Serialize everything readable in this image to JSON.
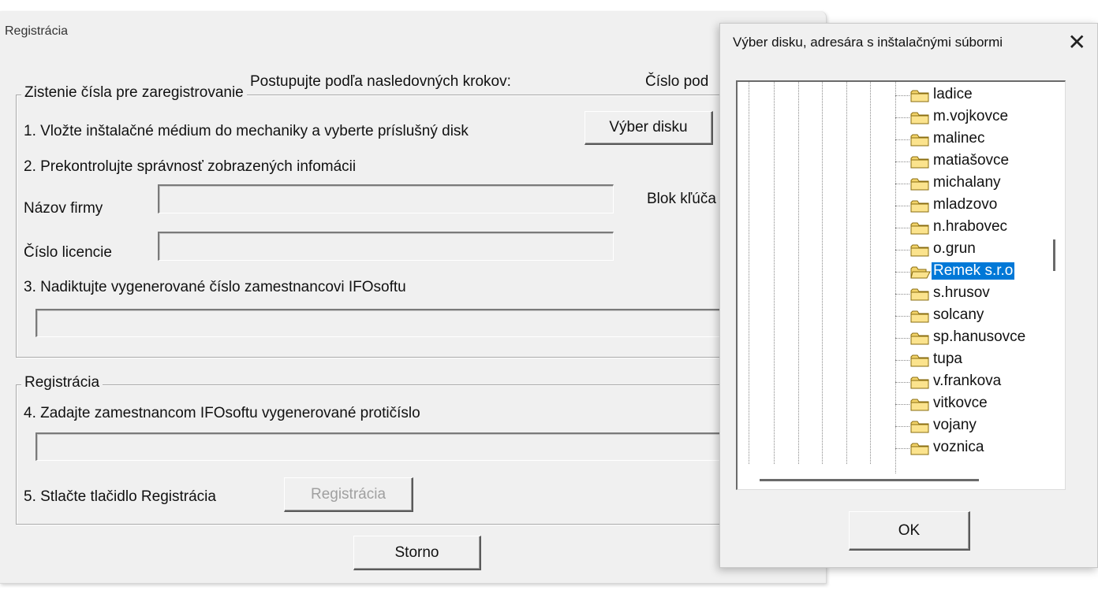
{
  "window": {
    "title": "Registrácia"
  },
  "header": {
    "instructions": "Postupujte podľa nasledovných krokov:",
    "cislo_label": "Číslo pod"
  },
  "group1": {
    "legend": "Zistenie čísla pre zaregistrovanie",
    "step1": "1. Vložte inštalačné médium do mechaniky a vyberte príslušný disk",
    "vyber_disku_button": "Výber disku",
    "step2": "2. Prekontrolujte správnosť zobrazených infomácii",
    "nazov_firmy_label": "Názov firmy",
    "nazov_firmy_value": "",
    "blok_kluca_label": "Blok kľúča",
    "cislo_licencie_label": "Číslo licencie",
    "cislo_licencie_value": "",
    "step3": "3. Nadiktujte vygenerované číslo zamestnancovi IFOsoftu",
    "generated_number_value": ""
  },
  "group2": {
    "legend": "Registrácia",
    "step4": "4. Zadajte zamestnancom IFOsoftu vygenerované protičíslo",
    "proticislo_value": "",
    "step5": "5. Stlačte tlačidlo Registrácia",
    "registracia_button": "Registrácia"
  },
  "storno_button": "Storno",
  "dialog": {
    "title": "Výber disku, adresára s inštalačnými súbormi",
    "close_icon": "close-icon",
    "ok_button": "OK",
    "folders": [
      {
        "name": "ladice",
        "selected": false
      },
      {
        "name": "m.vojkovce",
        "selected": false
      },
      {
        "name": "malinec",
        "selected": false
      },
      {
        "name": "matiašovce",
        "selected": false
      },
      {
        "name": "michalany",
        "selected": false
      },
      {
        "name": "mladzovo",
        "selected": false
      },
      {
        "name": "n.hrabovec",
        "selected": false
      },
      {
        "name": "o.grun",
        "selected": false
      },
      {
        "name": "Remek s.r.o",
        "selected": true
      },
      {
        "name": "s.hrusov",
        "selected": false
      },
      {
        "name": "solcany",
        "selected": false
      },
      {
        "name": "sp.hanusovce",
        "selected": false
      },
      {
        "name": "tupa",
        "selected": false
      },
      {
        "name": "v.frankova",
        "selected": false
      },
      {
        "name": "vitkovce",
        "selected": false
      },
      {
        "name": "vojany",
        "selected": false
      },
      {
        "name": "voznica",
        "selected": false
      }
    ]
  },
  "colors": {
    "selection": "#0078d7",
    "window_bg": "#f0f0f0"
  }
}
